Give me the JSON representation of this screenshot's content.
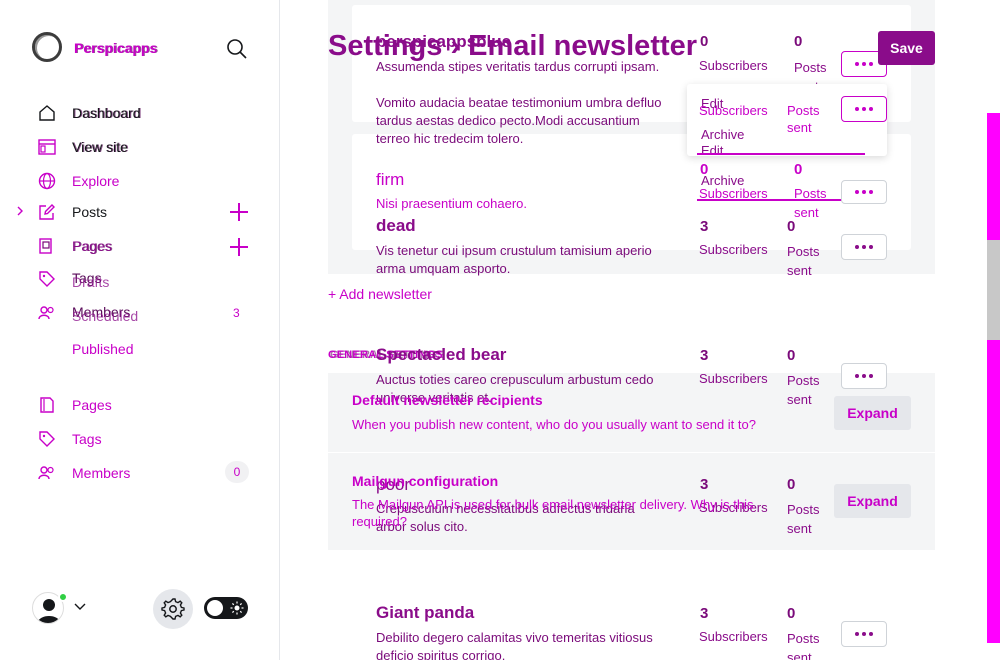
{
  "sidebar": {
    "brand": "Perspicapps",
    "brand_ghost": "Perspicapps",
    "nav": {
      "dashboard": "Dashboard",
      "dashboard_ghost": "Dashboard",
      "view_site": "View site",
      "view_site_ghost": "View site",
      "explore": "Explore",
      "posts": "Posts",
      "pages": "Pages",
      "pages_ghost": "Pages",
      "tags": "Tags",
      "drafts": "Drafts",
      "members": "Members",
      "scheduled": "Scheduled",
      "members_count": "3",
      "published": "Published",
      "pages_2": "Pages",
      "tags_2": "Tags",
      "members_2": "Members",
      "members_2_count": "0"
    }
  },
  "header": {
    "title": "Settings › Email newsletter",
    "save": "Save"
  },
  "newsletters": [
    {
      "name": "perspicappsblue",
      "desc": "Assumenda stipes veritatis tardus corrupti ipsam.",
      "subs": "0",
      "subs_label": "Subscribers",
      "posts": "0",
      "posts_label": "Posts sent"
    },
    {
      "name": "",
      "desc": "Vomito audacia beatae testimonium umbra defluo tardus aestas dedico pecto.Modi accusantium terreo hic tredecim tolero."
    },
    {
      "name": "firm",
      "desc": "Nisi praesentium cohaero.",
      "subs": "0",
      "subs_label": "Subscribers",
      "posts": "0",
      "posts_label": "Posts sent"
    },
    {
      "name": "dead",
      "desc": "Vis tenetur cui ipsum crustulum tamisium aperio arma umquam asporto.",
      "subs": "3",
      "subs_label": "Subscribers",
      "posts": "0",
      "posts_label": "Posts sent"
    },
    {
      "name": "Spectacled bear",
      "desc": "Auctus toties careo crepusculum arbustum cedo universe veritatis et.",
      "subs": "3",
      "subs_label": "Subscribers",
      "posts": "0",
      "posts_label": "Posts sent"
    },
    {
      "name": "poor",
      "desc": "Crepusculum necessitatibus adfectus tridaria arbor solus cito.",
      "subs": "3",
      "subs_label": "Subscribers",
      "posts": "0",
      "posts_label": "Posts sent"
    },
    {
      "name": "Giant panda",
      "desc": "Debilito degero calamitas vivo temeritas vitiosus deficio spiritus corrigo.",
      "subs": "3",
      "subs_label": "Subscribers",
      "posts": "0",
      "posts_label": "Posts sent"
    }
  ],
  "menu": {
    "edit": "Edit",
    "subscribers": "Subscribers",
    "posts": "Posts",
    "sent": "sent",
    "archive": "Archive",
    "edit_2": "Edit",
    "archive_2": "Archive",
    "zero_a": "0",
    "zero_b": "0",
    "subscribers_2": "Subscribers",
    "posts_2": "Posts",
    "sent_2": "sent"
  },
  "add_newsletter": "+ Add newsletter",
  "general": {
    "heading": "GENERAL SETTINGS",
    "heading_ghost": "GENERAL SETTINGS",
    "default_recipients": {
      "title": "Default newsletter recipients",
      "desc": "When you publish new content, who do you usually want to send it to?",
      "button": "Expand"
    },
    "mailgun": {
      "title": "Mailgun configuration",
      "desc": "The Mailgun API is used for bulk email newsletter delivery. Why is this required?",
      "button": "Expand"
    }
  },
  "colors": {
    "accent": "#c800c8",
    "dark_accent": "#8a0c8a",
    "panel": "#f4f5f6"
  }
}
